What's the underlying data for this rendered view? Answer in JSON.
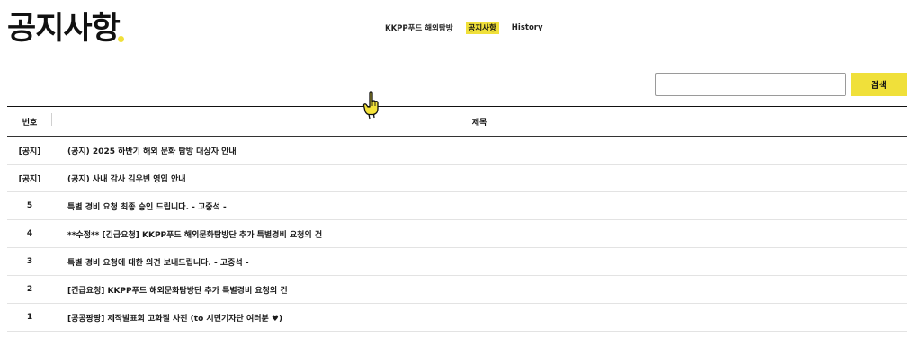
{
  "header": {
    "title": "공지사항"
  },
  "nav": {
    "items": [
      "KKPP푸드 해외탐방",
      "공지사항",
      "History"
    ],
    "active": "공지사항"
  },
  "search": {
    "value": "",
    "placeholder": "",
    "button_label": "검색"
  },
  "table": {
    "columns": [
      "번호",
      "제목"
    ],
    "rows": [
      {
        "num": "[공지]",
        "title": "(공지) 2025 하반기 해외 문화 탐방 대상자 안내"
      },
      {
        "num": "[공지]",
        "title": "(공지) 사내 감사 김우빈 영입 안내"
      },
      {
        "num": "5",
        "title": "특별 경비 요청 최종 승인 드립니다. - 고중석 -"
      },
      {
        "num": "4",
        "title": "**수정** [긴급요청] KKPP푸드 해외문화탐방단 추가 특별경비 요청의 건"
      },
      {
        "num": "3",
        "title": "특별 경비 요청에 대한 의견 보내드립니다. - 고중석 -"
      },
      {
        "num": "2",
        "title": "[긴급요청] KKPP푸드 해외문화탐방단 추가 특별경비 요청의 건"
      },
      {
        "num": "1",
        "title": "[콩콩팡팡] 제작발표회 고화질 사진 (to 시민기자단 여러분 ♥)"
      }
    ]
  },
  "cursor": {
    "icon": "pointing-hand-cursor-icon"
  },
  "colors": {
    "accent": "#f0e03a",
    "text": "#111111",
    "row_border": "#e3e3e3"
  }
}
